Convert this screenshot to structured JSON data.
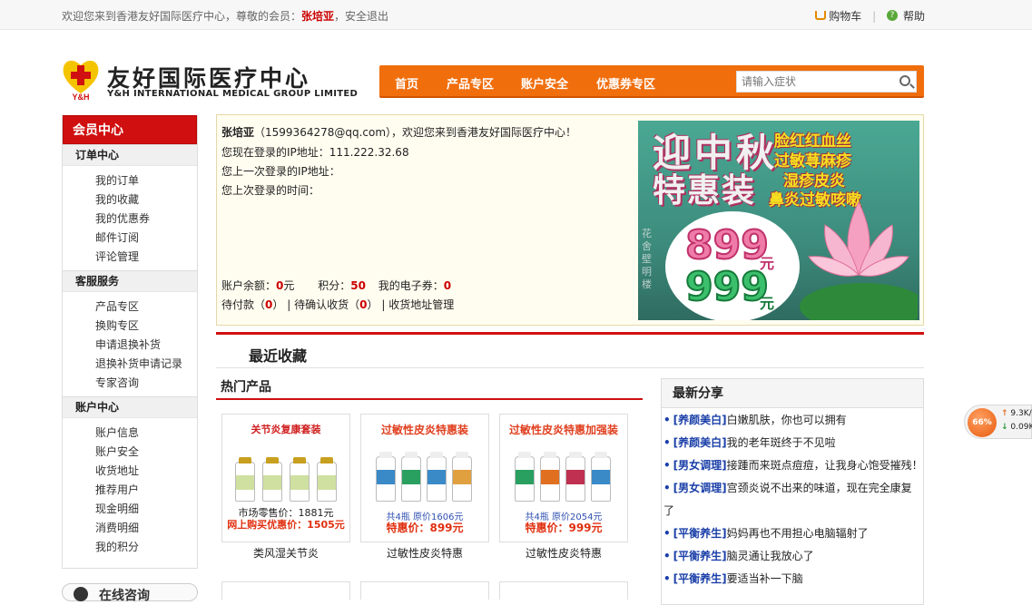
{
  "topbar": {
    "welcome_prefix": "欢迎您来到香港友好国际医疗中心，尊敬的会员：",
    "member_name": "张培亚",
    "separator": "，",
    "logout": "安全退出",
    "cart": "购物车",
    "divider": "|",
    "help": "帮助"
  },
  "logo": {
    "mark_text": "Y&H",
    "name_cn": "友好国际医疗中心",
    "name_en": "Y&H INTERNATIONAL MEDICAL GROUP LIMITED"
  },
  "nav": {
    "items": [
      "首页",
      "产品专区",
      "账户安全",
      "优惠券专区"
    ],
    "search_placeholder": "请输入症状"
  },
  "sidebar": {
    "title": "会员中心",
    "groups": [
      {
        "title": "订单中心",
        "items": [
          "我的订单",
          "我的收藏",
          "我的优惠券",
          "邮件订阅",
          "评论管理"
        ]
      },
      {
        "title": "客服服务",
        "items": [
          "产品专区",
          "换购专区",
          "申请退换补货",
          "退换补货申请记录",
          "专家咨询"
        ]
      },
      {
        "title": "账户中心",
        "items": [
          "账户信息",
          "账户安全",
          "收货地址",
          "推荐用户",
          "现金明细",
          "消费明细",
          "我的积分"
        ]
      }
    ],
    "online_consult": "在线咨询"
  },
  "info": {
    "greeting_name": "张培亚",
    "greeting_email": "（1599364278@qq.com），欢迎您来到香港友好国际医疗中心！",
    "ip_label": "您现在登录的IP地址：",
    "ip_value": "111.222.32.68",
    "last_ip_label": "您上一次登录的IP地址：",
    "last_time_label": "您上次登录的时间：",
    "balance_label": "账户余额：",
    "balance_value": "0",
    "balance_unit": "元",
    "points_label": "积分：",
    "points_value": "50",
    "coupons_label": "我的电子券：",
    "coupons_value": "0",
    "pending_pay_label": "待付款（",
    "pending_pay_value": "0",
    "pending_pay_close": "）",
    "link_divider": "|",
    "pending_receive_label": "待确认收货（",
    "pending_receive_value": "0",
    "pending_receive_close": "）",
    "address_link": "收货地址管理"
  },
  "banner": {
    "title_line1": "迎中秋",
    "title_line2": "特惠装",
    "tags": [
      "脸红红血丝",
      "过敏荨麻疹",
      "湿疹皮炎",
      "鼻炎过敏咳嗽"
    ],
    "price1": "899",
    "price2": "999",
    "unit": "元",
    "signature": "花舍壁明楼"
  },
  "favorites": {
    "title": "最近收藏"
  },
  "hot": {
    "title": "热门产品",
    "products": [
      {
        "headline": "关节炎复康套装",
        "line1": "市场零售价：1881元",
        "line2": "网上购买优惠价：1505元",
        "name": "类风湿关节炎"
      },
      {
        "headline": "过敏性皮炎特惠装",
        "line1": "共4瓶   原价1606元",
        "line2": "特惠价：899元",
        "name": "过敏性皮炎特惠"
      },
      {
        "headline": "过敏性皮炎特惠加强装",
        "line1": "共4瓶   原价2054元",
        "line2": "特惠价：999元",
        "name": "过敏性皮炎特惠"
      }
    ]
  },
  "share": {
    "title": "最新分享",
    "items": [
      {
        "cat": "[养颜美白]",
        "text": "白嫩肌肤，你也可以拥有"
      },
      {
        "cat": "[养颜美白]",
        "text": "我的老年斑终于不见啦"
      },
      {
        "cat": "[男女调理]",
        "text": "接踵而来斑点痘痘，让我身心饱受摧残！"
      },
      {
        "cat": "[男女调理]",
        "text": "宫颈炎说不出来的味道，现在完全康复"
      },
      {
        "cat": "",
        "text": "了"
      },
      {
        "cat": "[平衡养生]",
        "text": "妈妈再也不用担心电脑辐射了"
      },
      {
        "cat": "[平衡养生]",
        "text": "脑灵通让我放心了"
      },
      {
        "cat": "[平衡养生]",
        "text": "要适当补一下脑"
      }
    ]
  },
  "widget": {
    "percent": "66%",
    "up": "9.3K/s",
    "down": "0.09K/s"
  },
  "colors": {
    "brand_red": "#d01010",
    "nav_orange": "#f06e0c",
    "link_blue": "#1a3fa8"
  }
}
